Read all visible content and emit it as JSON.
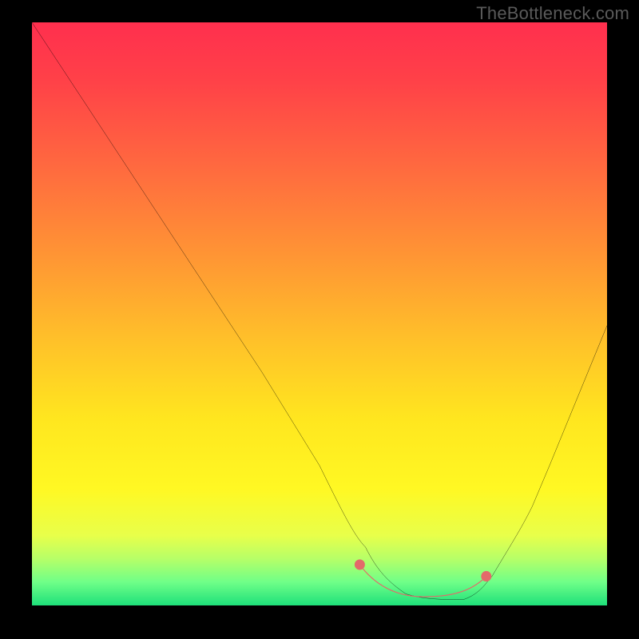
{
  "watermark": "TheBottleneck.com",
  "chart_data": {
    "type": "line",
    "title": "",
    "xlabel": "",
    "ylabel": "",
    "xlim": [
      0,
      100
    ],
    "ylim": [
      0,
      100
    ],
    "series": [
      {
        "name": "bottleneck-curve",
        "x": [
          0,
          10,
          20,
          30,
          40,
          50,
          58,
          62,
          65,
          70,
          75,
          80,
          85,
          90,
          95,
          100
        ],
        "y": [
          100,
          85,
          70,
          55,
          40,
          24,
          10,
          4,
          2,
          1,
          1,
          5,
          13,
          24,
          36,
          48
        ]
      }
    ],
    "annotations": [
      {
        "name": "optimum-marker-start",
        "x": 57,
        "y": 7,
        "color": "#e36a6a"
      },
      {
        "name": "optimum-marker-end",
        "x": 79,
        "y": 7,
        "color": "#e36a6a"
      }
    ],
    "colors": {
      "curve": "#000000",
      "marker": "#e36a6a"
    }
  }
}
